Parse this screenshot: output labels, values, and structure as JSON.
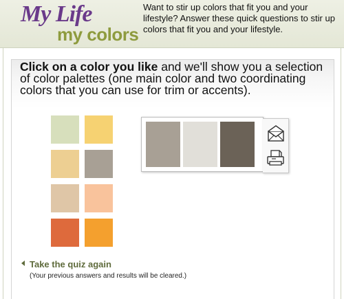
{
  "header": {
    "logo_line1": "My Life",
    "logo_line2": "my colors",
    "intro_text": "Want to stir up colors that fit you and your lifestyle? Answer these quick questions to stir up colors that fit you and your lifestyle."
  },
  "main": {
    "headline_bold": "Click on a color you like",
    "headline_rest": " and we'll show you a selection of color palettes (one main color and two coordinating colors that you can use for trim or accents).",
    "swatches": [
      {
        "color": "#d7dfbc"
      },
      {
        "color": "#f6d272"
      },
      {
        "color": "#edcf92"
      },
      {
        "color": "#a8a095"
      },
      {
        "color": "#dfc6a7"
      },
      {
        "color": "#f9c39c"
      },
      {
        "color": "#de6a3c"
      },
      {
        "color": "#f4a02e"
      }
    ],
    "palette": [
      {
        "color": "#a8a095"
      },
      {
        "color": "#e1dfd9"
      },
      {
        "color": "#6b6257"
      }
    ],
    "actions": {
      "email_icon": "envelope-icon",
      "print_icon": "printer-icon"
    },
    "quiz": {
      "link_label": "Take the quiz again",
      "note": "(Your previous answers and results will be cleared.)"
    }
  },
  "colors": {
    "logo_purple": "#6a3a8a",
    "logo_green": "#8e9b3e",
    "link_green": "#5f6b3c",
    "header_bg": "#e8ebdc"
  }
}
